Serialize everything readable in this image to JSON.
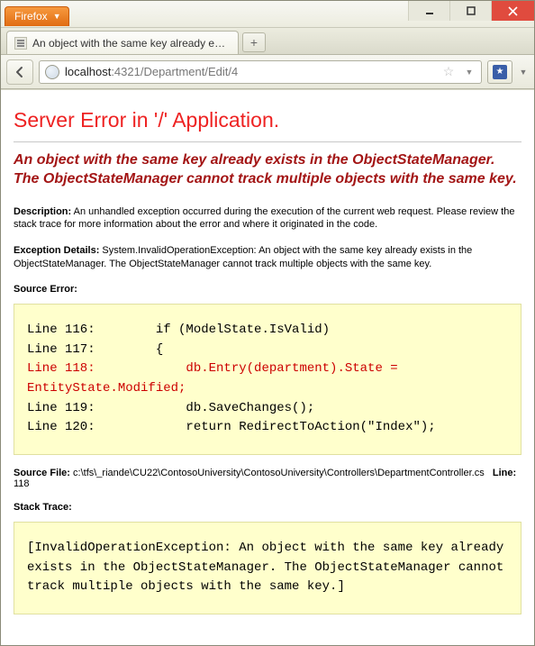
{
  "browser": {
    "app_menu_label": "Firefox",
    "tab_title": "An object with the same key already exis...",
    "newtab_glyph": "+",
    "url_host": "localhost",
    "url_path": ":4321/Department/Edit/4"
  },
  "error": {
    "title": "Server Error in '/' Application.",
    "subtitle": "An object with the same key already exists in the ObjectStateManager. The ObjectStateManager cannot track multiple objects with the same key.",
    "description_label": "Description:",
    "description_text": " An unhandled exception occurred during the execution of the current web request. Please review the stack trace for more information about the error and where it originated in the code.",
    "exception_label": "Exception Details:",
    "exception_text": " System.InvalidOperationException: An object with the same key already exists in the ObjectStateManager. The ObjectStateManager cannot track multiple objects with the same key.",
    "source_error_label": "Source Error:",
    "source_lines": {
      "l116": "Line 116:        if (ModelState.IsValid)",
      "l117": "Line 117:        {",
      "l118": "Line 118:            db.Entry(department).State = EntityState.Modified;",
      "l119": "Line 119:            db.SaveChanges();",
      "l120": "Line 120:            return RedirectToAction(\"Index\");"
    },
    "source_file_label": "Source File:",
    "source_file_path": " c:\\tfs\\_riande\\CU22\\ContosoUniversity\\ContosoUniversity\\Controllers\\DepartmentController.cs",
    "line_label": "Line:",
    "line_number": " 118",
    "stack_trace_label": "Stack Trace:",
    "stack_trace_text": "[InvalidOperationException: An object with the same key already exists in the ObjectStateManager. The ObjectStateManager cannot track multiple objects with the same key.]"
  }
}
